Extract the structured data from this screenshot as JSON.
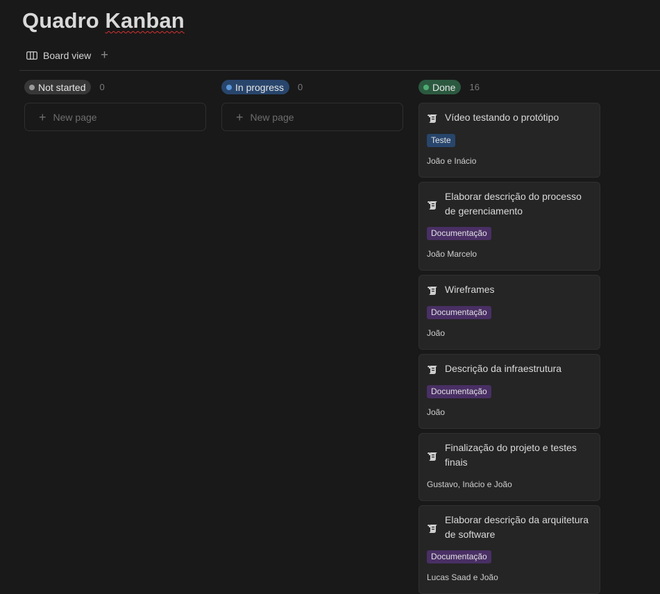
{
  "page": {
    "title_part1": "Quadro ",
    "title_part2": "Kanban"
  },
  "views": {
    "board_view_label": "Board view",
    "add_view_glyph": "+"
  },
  "icons": {
    "board": "board-view-icon",
    "add": "plus-icon",
    "doc": "document-icon"
  },
  "colors": {
    "background": "#191919",
    "not_started_pill": "#373737",
    "in_progress_pill": "#28456c",
    "done_pill": "#2b593f",
    "tag_teste": "#28456c",
    "tag_documentacao": "#492f64"
  },
  "columns": [
    {
      "status": "Not started",
      "count": "0",
      "new_page_label": "New page"
    },
    {
      "status": "In progress",
      "count": "0",
      "new_page_label": "New page"
    },
    {
      "status": "Done",
      "count": "16"
    }
  ],
  "done_cards": [
    {
      "title": "Vídeo testando o protótipo",
      "tag": "Teste",
      "people": "João e Inácio"
    },
    {
      "title": "Elaborar descrição do processo de gerenciamento",
      "tag": "Documentação",
      "people": "João Marcelo"
    },
    {
      "title": "Wireframes",
      "tag": "Documentação",
      "people": "João"
    },
    {
      "title": "Descrição da infraestrutura",
      "tag": "Documentação",
      "people": "João"
    },
    {
      "title": "Finalização do projeto e testes finais",
      "tag": "",
      "people": "Gustavo, Inácio e João"
    },
    {
      "title": "Elaborar descrição da arquitetura de software",
      "tag": "Documentação",
      "people": "Lucas Saad e João"
    }
  ]
}
